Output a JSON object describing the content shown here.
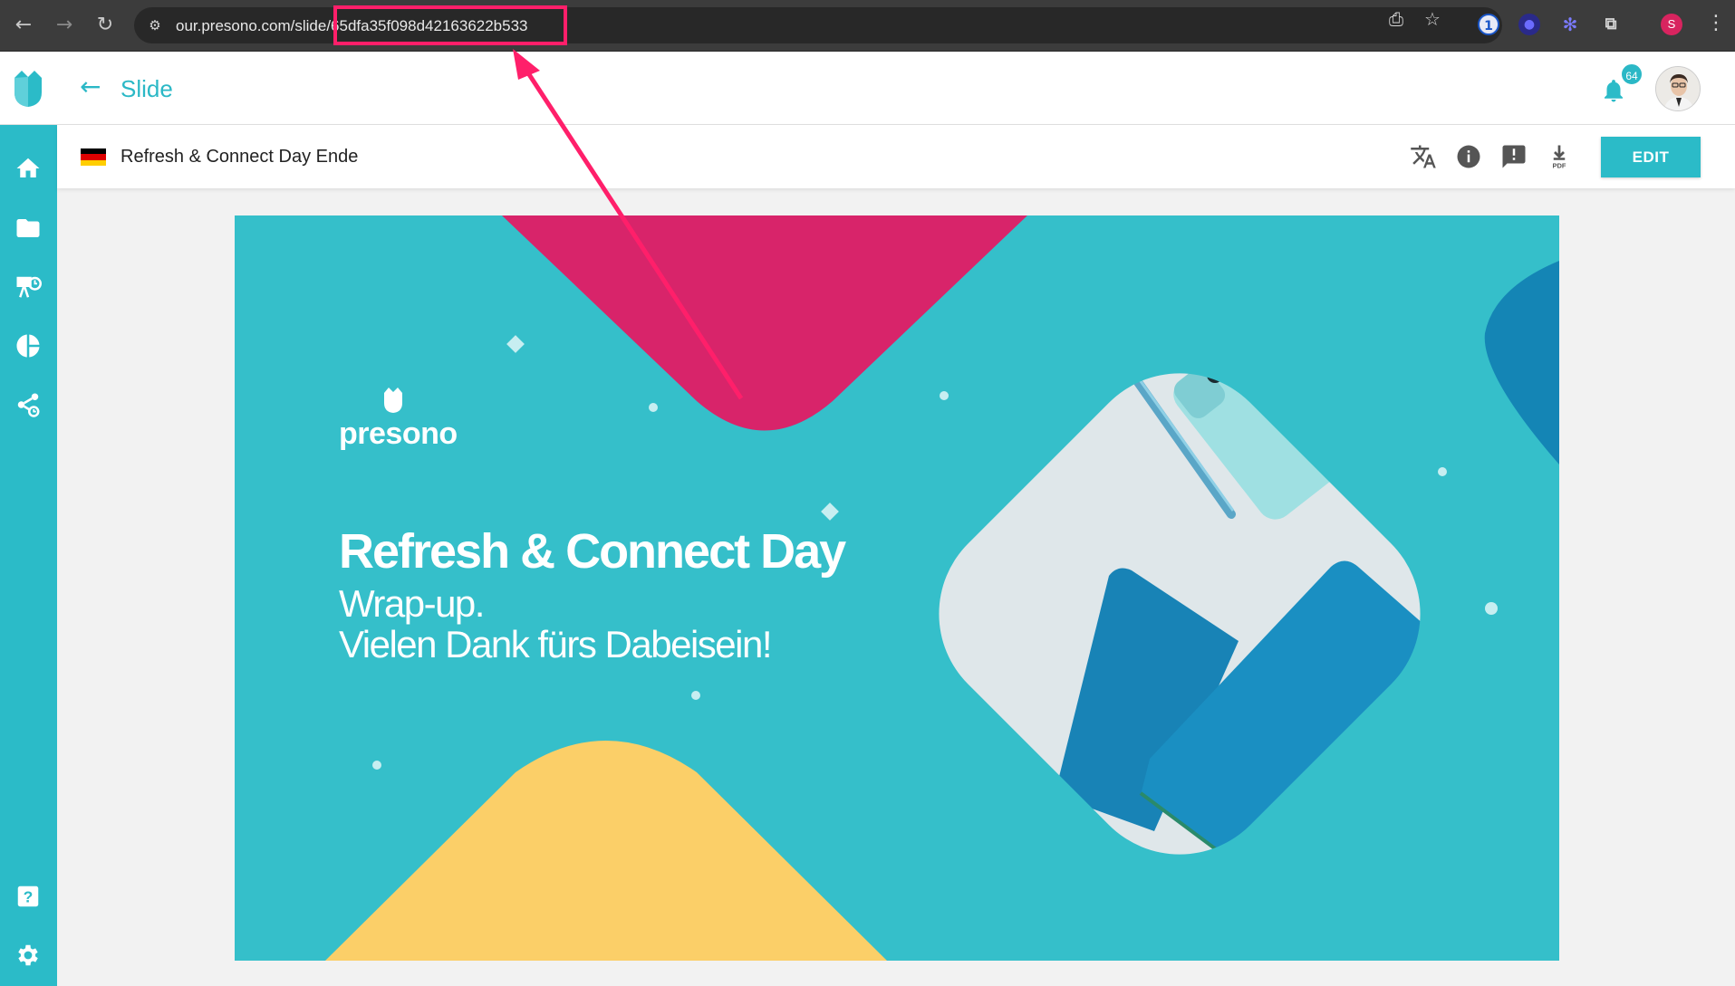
{
  "browser": {
    "url_prefix": "our.presono.com/slide",
    "url_id": "/65dfa35f098d42163622b533",
    "profile_initial": "S"
  },
  "header": {
    "title": "Slide",
    "notification_count": "64"
  },
  "toolbar": {
    "document_title": "Refresh & Connect Day Ende",
    "edit_label": "EDIT",
    "pdf_label": "PDF"
  },
  "slide": {
    "brand": "presono",
    "heading": "Refresh & Connect Day",
    "subline1": "Wrap-up.",
    "subline2": "Vielen Dank fürs Dabeisein!"
  },
  "colors": {
    "accent": "#2bbbc8",
    "slide_bg": "#35bfca",
    "magenta": "#d8246a",
    "yellow": "#fbcf68",
    "annotation": "#ff1f6a"
  }
}
